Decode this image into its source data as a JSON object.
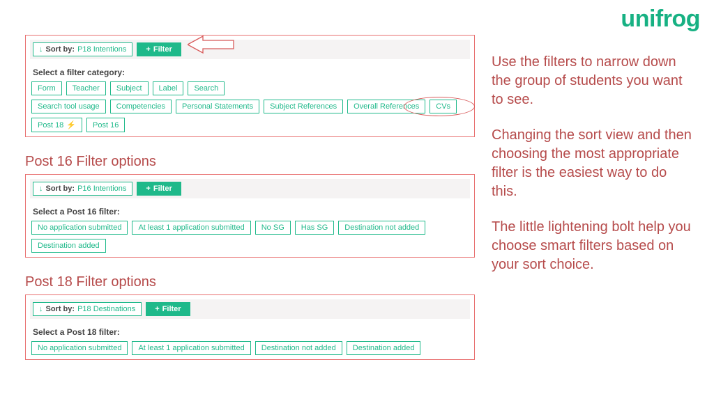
{
  "brand": "unifrog",
  "panel1": {
    "sort_label": "Sort by:",
    "sort_value": "P18 Intentions",
    "filter_label": "Filter",
    "prompt": "Select a filter category:",
    "chips_row1": [
      "Form",
      "Teacher",
      "Subject",
      "Label",
      "Search"
    ],
    "chips_row2": [
      "Search tool usage",
      "Competencies",
      "Personal Statements",
      "Subject References",
      "Overall References",
      "CVs"
    ],
    "chip_post18": "Post 18",
    "chip_post16": "Post 16"
  },
  "section16": {
    "title": "Post 16 Filter options",
    "sort_label": "Sort by:",
    "sort_value": "P16 Intentions",
    "filter_label": "Filter",
    "prompt": "Select a Post 16 filter:",
    "chips": [
      "No application submitted",
      "At least 1 application submitted",
      "No SG",
      "Has SG",
      "Destination not added",
      "Destination added"
    ]
  },
  "section18": {
    "title": "Post 18 Filter options",
    "sort_label": "Sort by:",
    "sort_value": "P18 Destinations",
    "filter_label": "Filter",
    "prompt": "Select a Post 18 filter:",
    "chips": [
      "No application submitted",
      "At least 1 application submitted",
      "Destination not added",
      "Destination added"
    ]
  },
  "explainer": {
    "p1": "Use the filters to narrow down the group of students you want to see.",
    "p2": "Changing the sort view and then choosing the most appropriate filter is the easiest way to do this.",
    "p3": "The little lightening bolt help you choose smart filters based on your sort choice."
  }
}
